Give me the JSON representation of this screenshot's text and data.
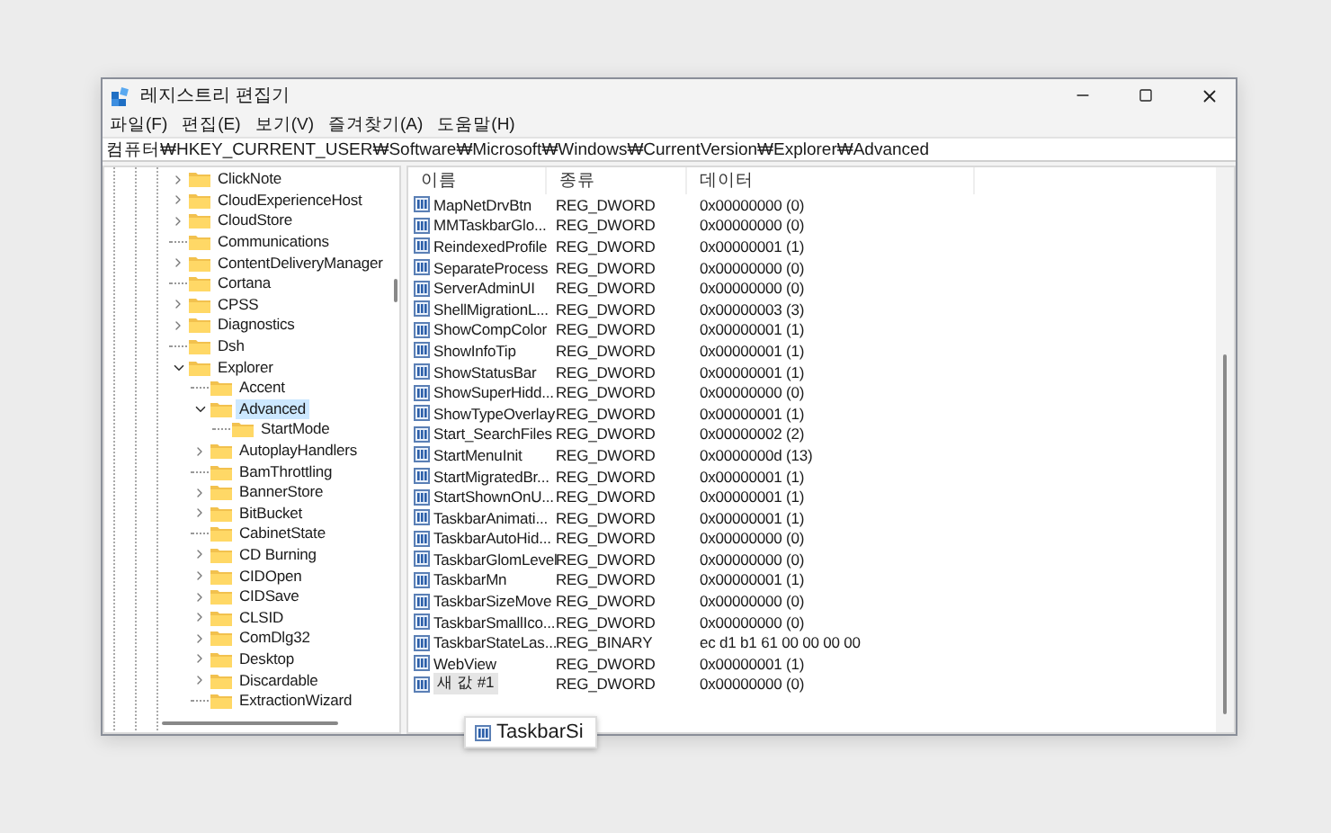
{
  "window": {
    "title": "레지스트리 편집기"
  },
  "menu": [
    "파일(F)",
    "편집(E)",
    "보기(V)",
    "즐겨찾기(A)",
    "도움말(H)"
  ],
  "address": "컴퓨터₩HKEY_CURRENT_USER₩Software₩Microsoft₩Windows₩CurrentVersion₩Explorer₩Advanced",
  "tree": {
    "items": [
      {
        "label": "ClickNote",
        "expandable": true,
        "expanded": false,
        "selected": false
      },
      {
        "label": "CloudExperienceHost",
        "expandable": true,
        "expanded": false,
        "selected": false
      },
      {
        "label": "CloudStore",
        "expandable": true,
        "expanded": false,
        "selected": false
      },
      {
        "label": "Communications",
        "expandable": false,
        "selected": false
      },
      {
        "label": "ContentDeliveryManager",
        "expandable": true,
        "expanded": false,
        "selected": false
      },
      {
        "label": "Cortana",
        "expandable": false,
        "selected": false
      },
      {
        "label": "CPSS",
        "expandable": true,
        "expanded": false,
        "selected": false
      },
      {
        "label": "Diagnostics",
        "expandable": true,
        "expanded": false,
        "selected": false
      },
      {
        "label": "Dsh",
        "expandable": false,
        "selected": false
      },
      {
        "label": "Explorer",
        "expandable": true,
        "expanded": true,
        "selected": false,
        "children": [
          {
            "label": "Accent",
            "expandable": false,
            "selected": false
          },
          {
            "label": "Advanced",
            "expandable": true,
            "expanded": true,
            "selected": true,
            "children": [
              {
                "label": "StartMode",
                "expandable": false,
                "selected": false
              }
            ]
          },
          {
            "label": "AutoplayHandlers",
            "expandable": true,
            "expanded": false,
            "selected": false
          },
          {
            "label": "BamThrottling",
            "expandable": false,
            "selected": false
          },
          {
            "label": "BannerStore",
            "expandable": true,
            "expanded": false,
            "selected": false
          },
          {
            "label": "BitBucket",
            "expandable": true,
            "expanded": false,
            "selected": false
          },
          {
            "label": "CabinetState",
            "expandable": false,
            "selected": false
          },
          {
            "label": "CD Burning",
            "expandable": true,
            "expanded": false,
            "selected": false
          },
          {
            "label": "CIDOpen",
            "expandable": true,
            "expanded": false,
            "selected": false
          },
          {
            "label": "CIDSave",
            "expandable": true,
            "expanded": false,
            "selected": false
          },
          {
            "label": "CLSID",
            "expandable": true,
            "expanded": false,
            "selected": false
          },
          {
            "label": "ComDlg32",
            "expandable": true,
            "expanded": false,
            "selected": false
          },
          {
            "label": "Desktop",
            "expandable": true,
            "expanded": false,
            "selected": false
          },
          {
            "label": "Discardable",
            "expandable": true,
            "expanded": false,
            "selected": false
          },
          {
            "label": "ExtractionWizard",
            "expandable": false,
            "selected": false
          }
        ]
      }
    ]
  },
  "table": {
    "columns": [
      "이름",
      "종류",
      "데이터"
    ],
    "rows": [
      {
        "name": "MapNetDrvBtn",
        "type": "REG_DWORD",
        "data": "0x00000000 (0)",
        "editing": false
      },
      {
        "name": "MMTaskbarGlo...",
        "type": "REG_DWORD",
        "data": "0x00000000 (0)",
        "editing": false
      },
      {
        "name": "ReindexedProfile",
        "type": "REG_DWORD",
        "data": "0x00000001 (1)",
        "editing": false
      },
      {
        "name": "SeparateProcess",
        "type": "REG_DWORD",
        "data": "0x00000000 (0)",
        "editing": false
      },
      {
        "name": "ServerAdminUI",
        "type": "REG_DWORD",
        "data": "0x00000000 (0)",
        "editing": false
      },
      {
        "name": "ShellMigrationL...",
        "type": "REG_DWORD",
        "data": "0x00000003 (3)",
        "editing": false
      },
      {
        "name": "ShowCompColor",
        "type": "REG_DWORD",
        "data": "0x00000001 (1)",
        "editing": false
      },
      {
        "name": "ShowInfoTip",
        "type": "REG_DWORD",
        "data": "0x00000001 (1)",
        "editing": false
      },
      {
        "name": "ShowStatusBar",
        "type": "REG_DWORD",
        "data": "0x00000001 (1)",
        "editing": false
      },
      {
        "name": "ShowSuperHidd...",
        "type": "REG_DWORD",
        "data": "0x00000000 (0)",
        "editing": false
      },
      {
        "name": "ShowTypeOverlay",
        "type": "REG_DWORD",
        "data": "0x00000001 (1)",
        "editing": false
      },
      {
        "name": "Start_SearchFiles",
        "type": "REG_DWORD",
        "data": "0x00000002 (2)",
        "editing": false
      },
      {
        "name": "StartMenuInit",
        "type": "REG_DWORD",
        "data": "0x0000000d (13)",
        "editing": false
      },
      {
        "name": "StartMigratedBr...",
        "type": "REG_DWORD",
        "data": "0x00000001 (1)",
        "editing": false
      },
      {
        "name": "StartShownOnU...",
        "type": "REG_DWORD",
        "data": "0x00000001 (1)",
        "editing": false
      },
      {
        "name": "TaskbarAnimati...",
        "type": "REG_DWORD",
        "data": "0x00000001 (1)",
        "editing": false
      },
      {
        "name": "TaskbarAutoHid...",
        "type": "REG_DWORD",
        "data": "0x00000000 (0)",
        "editing": false
      },
      {
        "name": "TaskbarGlomLevel",
        "type": "REG_DWORD",
        "data": "0x00000000 (0)",
        "editing": false
      },
      {
        "name": "TaskbarMn",
        "type": "REG_DWORD",
        "data": "0x00000001 (1)",
        "editing": false
      },
      {
        "name": "TaskbarSizeMove",
        "type": "REG_DWORD",
        "data": "0x00000000 (0)",
        "editing": false
      },
      {
        "name": "TaskbarSmallIco...",
        "type": "REG_DWORD",
        "data": "0x00000000 (0)",
        "editing": false
      },
      {
        "name": "TaskbarStateLas...",
        "type": "REG_BINARY",
        "data": "ec d1 b1 61 00 00 00 00",
        "editing": false
      },
      {
        "name": "WebView",
        "type": "REG_DWORD",
        "data": "0x00000001 (1)",
        "editing": false
      },
      {
        "name": "새 값 #1",
        "type": "REG_DWORD",
        "data": "0x00000000 (0)",
        "editing": true
      }
    ]
  },
  "drag_preview": {
    "label": "TaskbarSi"
  }
}
